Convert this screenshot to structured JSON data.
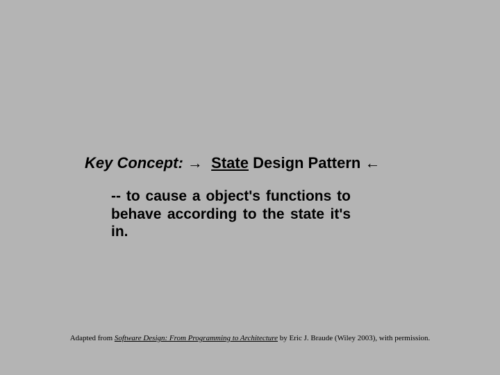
{
  "heading": {
    "key_concept": "Key Concept:",
    "arrow_right": "→",
    "state": "State",
    "design_pattern": "Design Pattern",
    "arrow_left": "←"
  },
  "body": {
    "text": "-- to cause a object's functions to behave according to the state it's in."
  },
  "footer": {
    "prefix": "Adapted from ",
    "book_title": "Software Design: From Programming to Architecture",
    "suffix": " by Eric J. Braude (Wiley 2003), with permission."
  }
}
